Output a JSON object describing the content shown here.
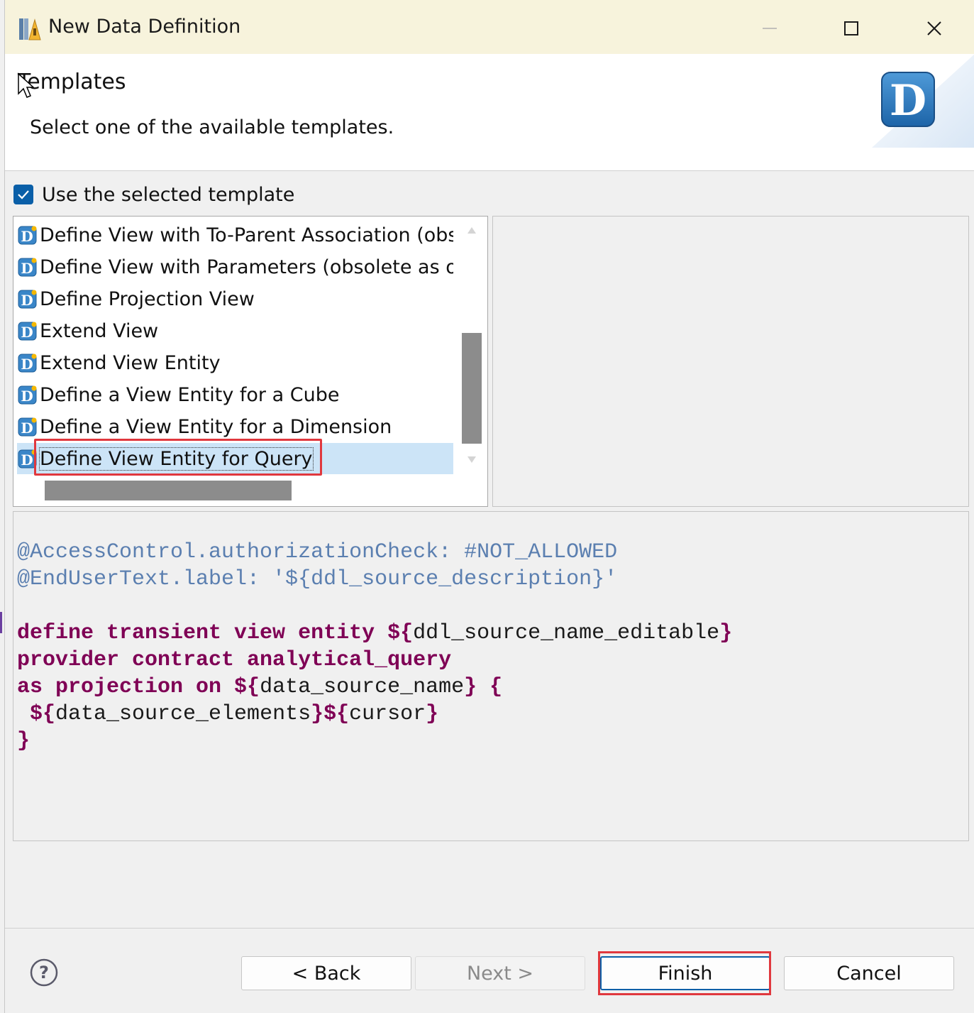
{
  "window": {
    "title": "New Data Definition"
  },
  "header": {
    "title": "Templates",
    "description": "Select one of the available templates.",
    "graphic_letter": "D"
  },
  "use_template": {
    "label": "Use the selected template",
    "checked": true
  },
  "templates": [
    {
      "label": "Define View with To-Parent Association (obso",
      "selected": false
    },
    {
      "label": "Define View with Parameters (obsolete as of",
      "selected": false
    },
    {
      "label": "Define Projection View",
      "selected": false
    },
    {
      "label": "Extend View",
      "selected": false
    },
    {
      "label": "Extend View Entity",
      "selected": false
    },
    {
      "label": "Define a View Entity for a Cube",
      "selected": false
    },
    {
      "label": "Define a View Entity for a Dimension",
      "selected": false
    },
    {
      "label": "Define View Entity for Query",
      "selected": true
    }
  ],
  "preview": {
    "lines": [
      "@AccessControl.authorizationCheck: #NOT_ALLOWED",
      "@EndUserText.label: '${ddl_source_description}'",
      "",
      "define transient view entity ${ddl_source_name_editable}",
      "provider contract analytical_query",
      "as projection on ${data_source_name} {",
      " ${data_source_elements}${cursor}",
      "}"
    ]
  },
  "buttons": {
    "back": "< Back",
    "next": "Next >",
    "finish": "Finish",
    "cancel": "Cancel"
  },
  "colors": {
    "title_bar": "#f7f3dc",
    "annotation": "#5b7fb0",
    "keyword": "#7f0055",
    "selection": "#cce4f7",
    "highlight": "#e0383e",
    "accent": "#0a5fa8"
  }
}
